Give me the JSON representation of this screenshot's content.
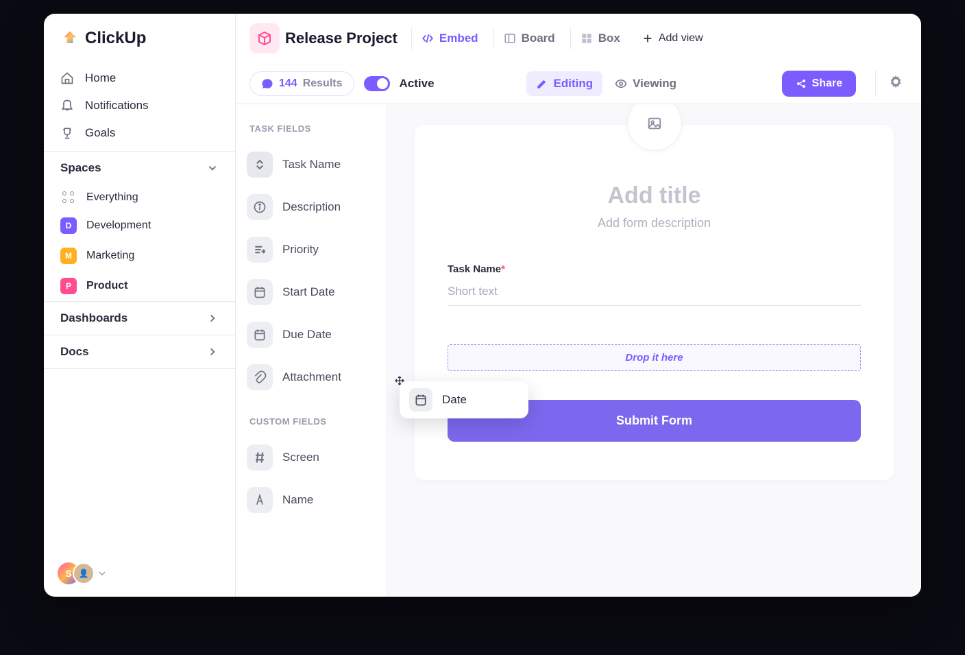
{
  "logo": {
    "text": "ClickUp"
  },
  "sidebar": {
    "nav": {
      "home": "Home",
      "notifications": "Notifications",
      "goals": "Goals"
    },
    "spaces_header": "Spaces",
    "spaces": {
      "everything": "Everything",
      "items": [
        {
          "letter": "D",
          "label": "Development",
          "color": "#7b5cff"
        },
        {
          "letter": "M",
          "label": "Marketing",
          "color": "#ffb020"
        },
        {
          "letter": "P",
          "label": "Product",
          "color": "#ff4d8f"
        }
      ]
    },
    "dashboards": "Dashboards",
    "docs": "Docs",
    "user_initial": "S"
  },
  "header": {
    "project_title": "Release Project",
    "views": {
      "embed": "Embed",
      "board": "Board",
      "box": "Box",
      "add": "Add view"
    }
  },
  "toolbar": {
    "results_count": "144",
    "results_label": "Results",
    "active_label": "Active",
    "editing": "Editing",
    "viewing": "Viewing",
    "share": "Share"
  },
  "fields": {
    "task_section": "TASK FIELDS",
    "task": [
      "Task Name",
      "Description",
      "Priority",
      "Start Date",
      "Due Date",
      "Attachment"
    ],
    "custom_section": "CUSTOM FIELDS",
    "custom": [
      "Screen",
      "Name"
    ]
  },
  "form": {
    "title_placeholder": "Add title",
    "desc_placeholder": "Add form description",
    "field_label": "Task Name",
    "required": "*",
    "input_placeholder": "Short text",
    "dropzone_text": "Drop it here",
    "submit": "Submit Form"
  },
  "drag": {
    "label": "Date"
  }
}
